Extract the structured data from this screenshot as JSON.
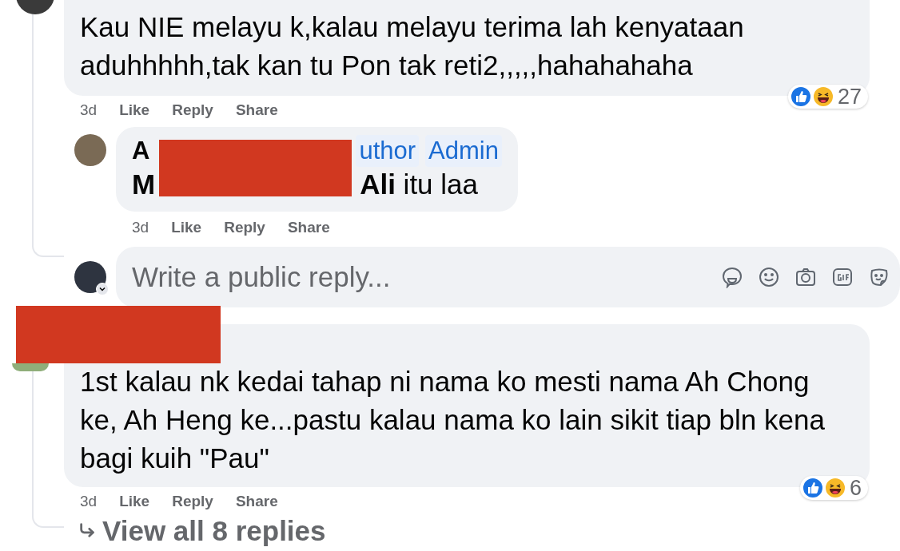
{
  "first_comment": {
    "body_lines": [
      "Kau NIE melayu k,kalau melayu terima lah kenyataan",
      "aduhhhhh,tak kan tu Pon tak reti2,,,,,hahahahaha"
    ],
    "time": "3d",
    "actions": [
      "Like",
      "Reply",
      "Share"
    ],
    "reaction_count": "27"
  },
  "reply": {
    "author_visible": "A",
    "redacted": true,
    "badges": [
      "uthor",
      "Admin"
    ],
    "body_start": "M",
    "body_end": "**Ali** itu laa",
    "time": "3d",
    "actions": [
      "Like",
      "Reply",
      "Share"
    ]
  },
  "reply_box": {
    "placeholder": "Write a public reply..."
  },
  "second_comment": {
    "name_redacted": true,
    "body_lines": [
      "1st kalau nk kedai tahap ni nama ko mesti nama Ah Chong",
      "ke, Ah Heng ke...pastu kalau nama ko lain sikit tiap bln kena",
      "bagi kuih \"Pau\""
    ],
    "time": "3d",
    "actions": [
      "Like",
      "Reply",
      "Share"
    ],
    "reaction_count": "6"
  },
  "view_replies": {
    "label": "View all 8 replies"
  }
}
